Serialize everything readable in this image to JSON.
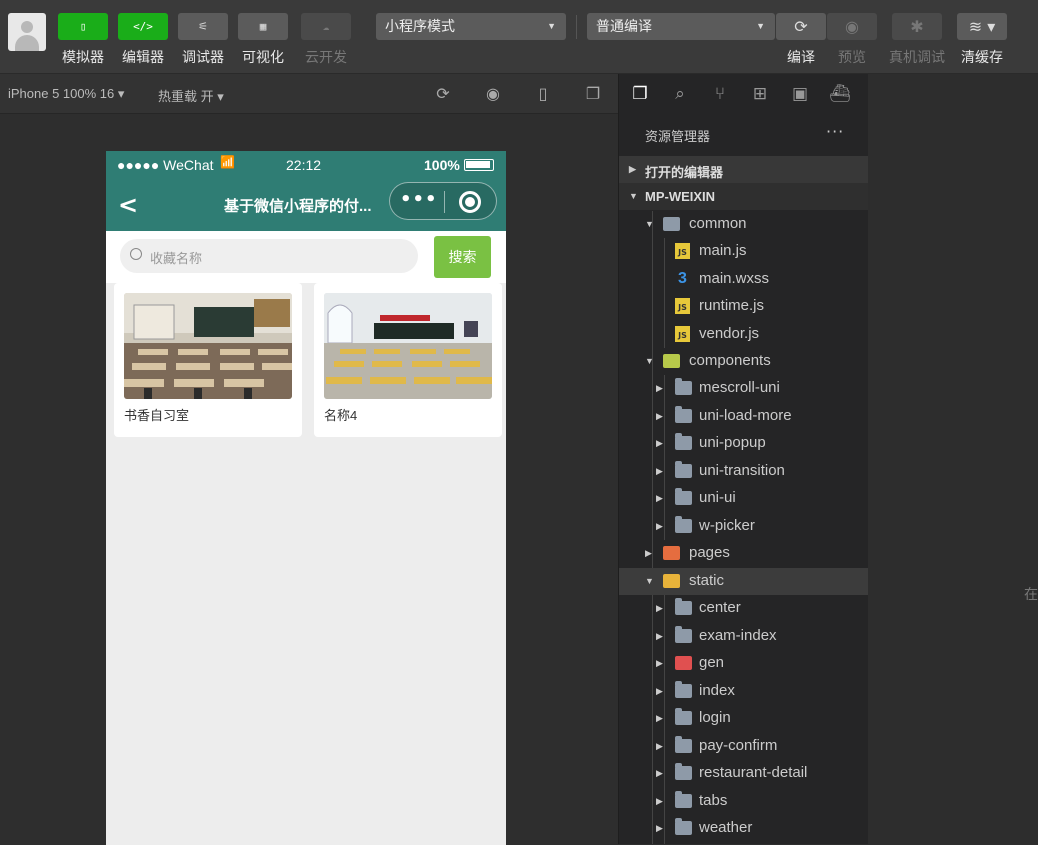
{
  "toolbar": {
    "buttons": [
      {
        "label": "模拟器",
        "icon": "phone-icon"
      },
      {
        "label": "编辑器",
        "icon": "code-icon"
      },
      {
        "label": "调试器",
        "icon": "sliders-icon"
      },
      {
        "label": "可视化",
        "icon": "layout-icon"
      },
      {
        "label": "云开发",
        "icon": "cloud-icon"
      }
    ],
    "mode_select": "小程序模式",
    "compile_select": "普通编译",
    "actions": [
      {
        "label": "编译",
        "icon": "refresh-icon"
      },
      {
        "label": "预览",
        "icon": "eye-icon"
      },
      {
        "label": "真机调试",
        "icon": "bug-icon"
      },
      {
        "label": "清缓存",
        "icon": "layers-icon"
      }
    ]
  },
  "simulator": {
    "device": "iPhone 5 100% 16 ▾",
    "hot_reload": "热重载 开 ▾",
    "status": {
      "signal": "●●●●● WeChat",
      "time": "22:12",
      "battery": "100%"
    },
    "nav_title": "基于微信小程序的付...",
    "back": "<",
    "capsule_dots": "•••",
    "search_placeholder": "收藏名称",
    "search_button": "搜索",
    "cards": [
      {
        "name": "书香自习室"
      },
      {
        "name": "名称4"
      }
    ]
  },
  "explorer": {
    "title": "资源管理器",
    "more": "···",
    "open_editors": "打开的编辑器",
    "project": "MP-WEIXIN",
    "tree": [
      {
        "label": "common",
        "kind": "open"
      },
      {
        "label": "main.js",
        "kind": "js"
      },
      {
        "label": "main.wxss",
        "kind": "css"
      },
      {
        "label": "runtime.js",
        "kind": "js"
      },
      {
        "label": "vendor.js",
        "kind": "js"
      },
      {
        "label": "components",
        "kind": "comp"
      },
      {
        "label": "mescroll-uni",
        "kind": "folder"
      },
      {
        "label": "uni-load-more",
        "kind": "folder"
      },
      {
        "label": "uni-popup",
        "kind": "folder"
      },
      {
        "label": "uni-transition",
        "kind": "folder"
      },
      {
        "label": "uni-ui",
        "kind": "folder"
      },
      {
        "label": "w-picker",
        "kind": "folder"
      },
      {
        "label": "pages",
        "kind": "red"
      },
      {
        "label": "static",
        "kind": "static"
      },
      {
        "label": "center",
        "kind": "folder"
      },
      {
        "label": "exam-index",
        "kind": "folder"
      },
      {
        "label": "gen",
        "kind": "gen"
      },
      {
        "label": "index",
        "kind": "folder"
      },
      {
        "label": "login",
        "kind": "folder"
      },
      {
        "label": "pay-confirm",
        "kind": "folder"
      },
      {
        "label": "restaurant-detail",
        "kind": "folder"
      },
      {
        "label": "tabs",
        "kind": "folder"
      },
      {
        "label": "weather",
        "kind": "folder"
      }
    ]
  },
  "editor_edge_text": "在"
}
